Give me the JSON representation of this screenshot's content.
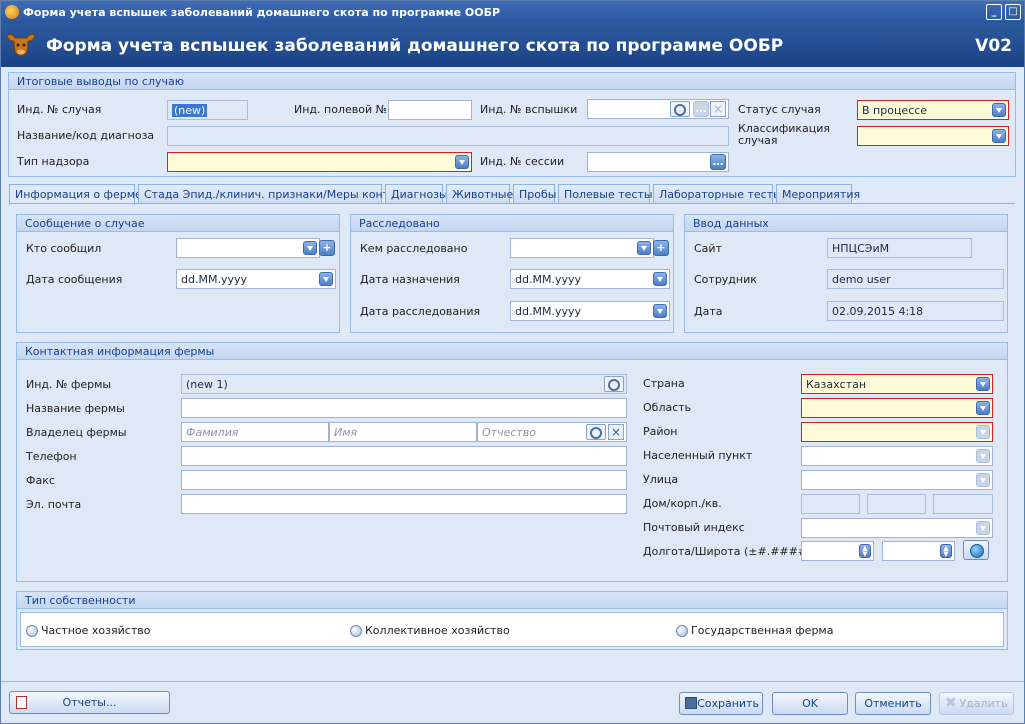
{
  "window": {
    "title": "Форма учета вспышек заболеваний домашнего скота по программе ООБР"
  },
  "header": {
    "title": "Форма учета вспышек заболеваний домашнего скота по программе ООБР",
    "version": "V02"
  },
  "summary": {
    "title": "Итоговые выводы по случаю",
    "case_id_label": "Инд. № случая",
    "case_id_value": "(new)",
    "field_id_label": "Инд. полевой №",
    "field_id_value": "",
    "outbreak_id_label": "Инд. № вспышки",
    "outbreak_id_value": "",
    "status_label": "Статус случая",
    "status_value": "В процессе",
    "diagnosis_label": "Название/код диагноза",
    "diagnosis_value": "",
    "classification_label": "Классификация случая",
    "classification_value": "",
    "surveillance_label": "Тип надзора",
    "surveillance_value": "",
    "session_label": "Инд. № сессии",
    "session_value": ""
  },
  "tabs": [
    "Информация о ферме",
    "Стада Эпид./клинич. признаки/Меры контроля",
    "Диагнозы",
    "Животные",
    "Пробы",
    "Полевые тесты",
    "Лабораторные тесты",
    "Мероприятия"
  ],
  "report": {
    "title": "Сообщение о случае",
    "who_label": "Кто сообщил",
    "who_value": "",
    "date_label": "Дата сообщения",
    "date_value": "dd.MM.yyyy"
  },
  "investigated": {
    "title": "Расследовано",
    "by_label": "Кем расследовано",
    "by_value": "",
    "assigned_label": "Дата назначения",
    "assigned_value": "dd.MM.yyyy",
    "date_label": "Дата расследования",
    "date_value": "dd.MM.yyyy"
  },
  "entry": {
    "title": "Ввод данных",
    "site_label": "Сайт",
    "site_value": "НПЦСЭиМ",
    "employee_label": "Сотрудник",
    "employee_value": "demo user",
    "date_label": "Дата",
    "date_value": "02.09.2015 4:18"
  },
  "farm": {
    "title": "Контактная информация фермы",
    "farm_id_label": "Инд. № фермы",
    "farm_id_value": "(new 1)",
    "name_label": "Название фермы",
    "name_value": "",
    "owner_label": "Владелец фермы",
    "last_name_placeholder": "Фамилия",
    "first_name_placeholder": "Имя",
    "middle_name_placeholder": "Отчество",
    "phone_label": "Телефон",
    "phone_value": "",
    "fax_label": "Факс",
    "fax_value": "",
    "email_label": "Эл. почта",
    "email_value": "",
    "country_label": "Страна",
    "country_value": "Казахстан",
    "region_label": "Область",
    "region_value": "",
    "district_label": "Район",
    "district_value": "",
    "settlement_label": "Населенный пункт",
    "settlement_value": "",
    "street_label": "Улица",
    "street_value": "",
    "house_label": "Дом/корп./кв.",
    "postal_label": "Почтовый индекс",
    "postal_value": "",
    "coords_label": "Долгота/Широта (±#.#####°)"
  },
  "ownership": {
    "title": "Тип собственности",
    "options": [
      "Частное хозяйство",
      "Коллективное хозяйство",
      "Государственная ферма"
    ]
  },
  "footer": {
    "reports": "Отчеты...",
    "save": "Сохранить",
    "ok": "OK",
    "cancel": "Отменить",
    "delete": "Удалить"
  },
  "colors": {
    "header": "#1b4287",
    "panel_bg": "#dfe8f6",
    "required_border": "#d62020",
    "required_bg": "#fffbd9"
  }
}
